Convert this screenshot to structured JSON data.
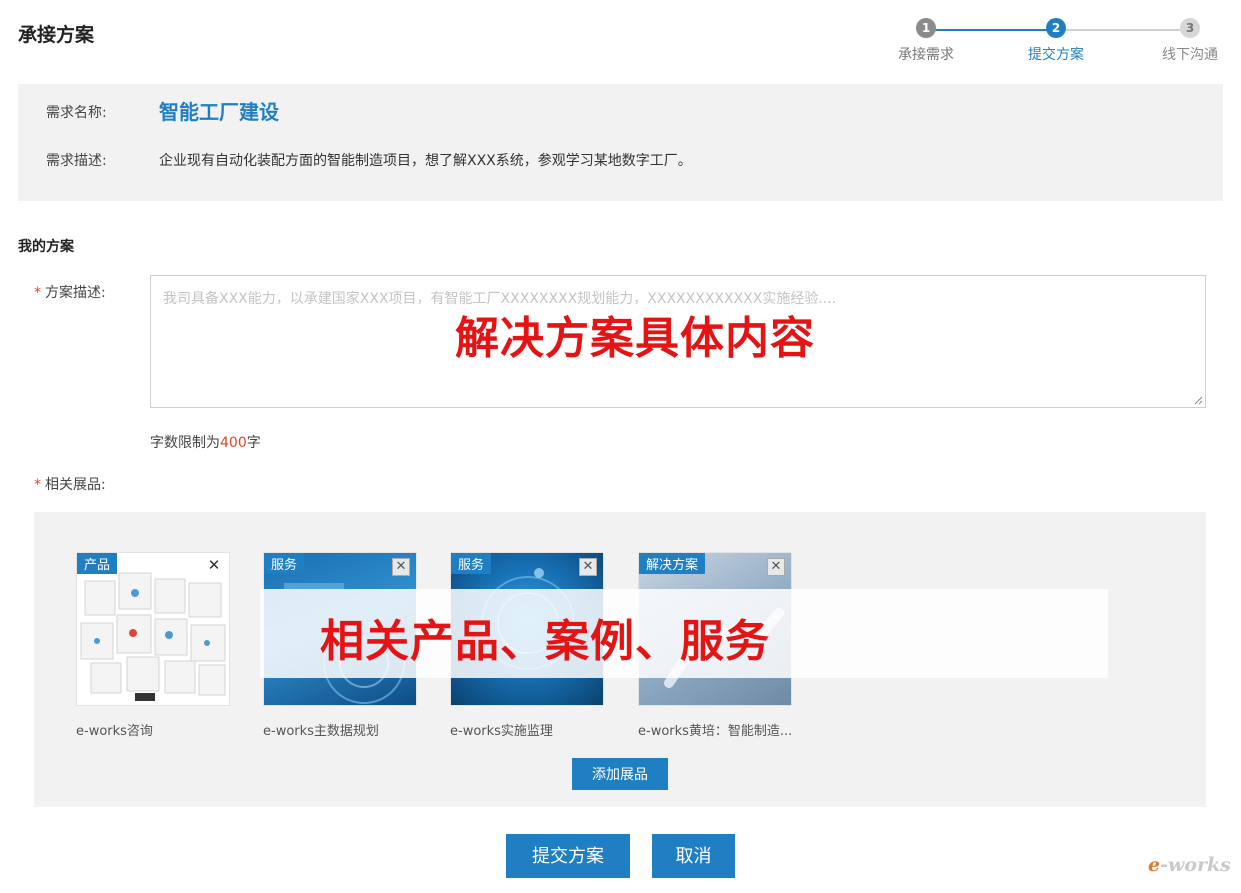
{
  "page": {
    "title": "承接方案"
  },
  "stepper": {
    "steps": [
      {
        "num": "1",
        "label": "承接需求"
      },
      {
        "num": "2",
        "label": "提交方案"
      },
      {
        "num": "3",
        "label": "线下沟通"
      }
    ],
    "active_step": 2,
    "colors": {
      "active": "#1f7fc2",
      "done": "#8c8c8c",
      "pending": "#d7d7d7"
    }
  },
  "requirement": {
    "name_label": "需求名称:",
    "name": "智能工厂建设",
    "desc_label": "需求描述:",
    "desc": "企业现有自动化装配方面的智能制造项目，想了解XXX系统，参观学习某地数字工厂。"
  },
  "my_plan": {
    "title": "我的方案",
    "desc_star": "*",
    "desc_label": "方案描述:",
    "desc_placeholder": "我司具备XXX能力，以承建国家XXX项目，有智能工厂XXXXXXXX规划能力，XXXXXXXXXXXX实施经验....",
    "overlay_caption": "解决方案具体内容",
    "limit_prefix": "字数限制为",
    "limit_num": "400",
    "limit_suffix": "字"
  },
  "products": {
    "star": "*",
    "label": "相关展品:",
    "items": [
      {
        "tag": "产品",
        "name": "e-works咨询",
        "icon": "cubes-image"
      },
      {
        "tag": "服务",
        "name": "e-works主数据规划",
        "icon": "data-planning-image"
      },
      {
        "tag": "服务",
        "name": "e-works实施监理",
        "icon": "supervision-image"
      },
      {
        "tag": "解决方案",
        "name": "e-works黄培：智能制造...",
        "icon": "smart-manufacturing-image"
      }
    ],
    "overlay_caption": "相关产品、案例、服务",
    "add_label": "添加展品",
    "close_glyph": "✕"
  },
  "actions": {
    "submit_label": "提交方案",
    "cancel_label": "取消"
  },
  "watermark": {
    "e": "e",
    "rest": "-works"
  },
  "colors": {
    "accent": "#1f7fc2",
    "required": "#e0452a",
    "overlay_red": "#e41414"
  }
}
